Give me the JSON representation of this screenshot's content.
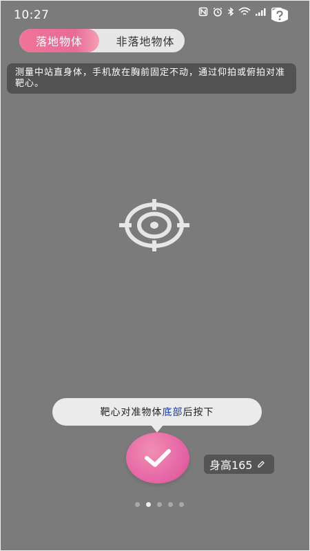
{
  "status_bar": {
    "time": "10:27",
    "icons": [
      "nfc-icon",
      "alarm-icon",
      "bluetooth-icon",
      "wifi-icon",
      "signal-icon",
      "battery-icon"
    ]
  },
  "help_icon": "help-icon",
  "mode_switch": {
    "active": "落地物体",
    "inactive": "非落地物体"
  },
  "tip": "测量中站直身体，手机放在胸前固定不动，通过仰拍或俯拍对准靶心。",
  "target_icon": "crosshair-target-icon",
  "bubble": {
    "prefix": "靶心对准物体",
    "highlight": "底部",
    "suffix": "后按下"
  },
  "confirm_icon": "check-icon",
  "height_chip": {
    "label": "身高165",
    "icon": "pencil-icon"
  },
  "pager": {
    "count": 5,
    "active_index": 1
  },
  "colors": {
    "background": "#7b7b7b",
    "accent_pink": "#e86b97",
    "highlight_blue": "#1a3aa8"
  }
}
